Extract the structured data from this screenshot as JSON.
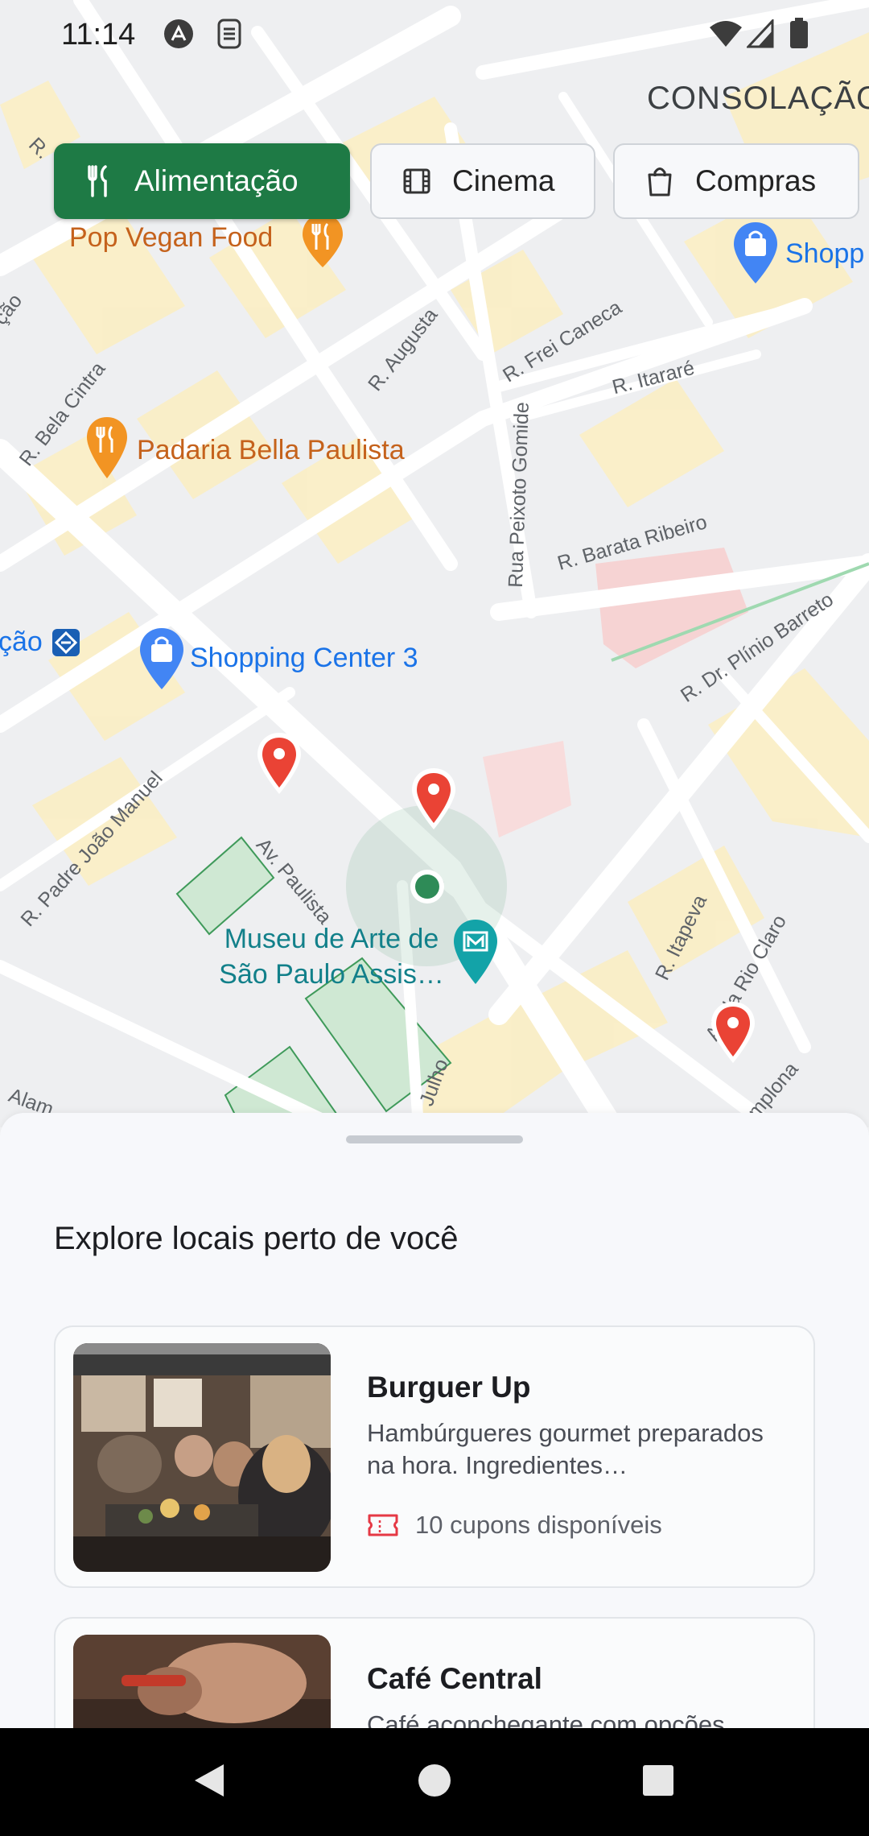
{
  "status_bar": {
    "time": "11:14",
    "icons": [
      "assistant-icon",
      "sim-icon",
      "wifi-icon",
      "signal-icon",
      "battery-icon"
    ]
  },
  "map": {
    "district": "CONSOLAÇÃO",
    "streets": {
      "r_bela_cintra": "R. Bela Cintra",
      "r_augusta": "R. Augusta",
      "r_frei_caneca": "R. Frei Caneca",
      "r_itarare": "R. Itararé",
      "rua_peixoto_gomide": "Rua Peixoto Gomide",
      "r_barata_ribeiro": "R. Barata Ribeiro",
      "r_dr_plinio_barreto": "R. Dr. Plínio Barreto",
      "r_padre_joao_manuel": "R. Padre João Manuel",
      "av_paulista": "Av. Paulista",
      "r_itapeva": "R. Itapeva",
      "al_rio_claro": "Al. da Rio Claro",
      "julho": "Julho",
      "pamplona": "mplona",
      "alam": "Alam",
      "r_corner": "R.",
      "cao": "ção",
      "sao_left": "ção"
    },
    "pois": {
      "pop_vegan": "Pop Vegan Food",
      "padaria": "Padaria Bella Paulista",
      "shopping3": "Shopping Center 3",
      "shopping_right": "Shopp",
      "masp": "Museu de Arte de São Paulo Assis…"
    }
  },
  "categories": [
    {
      "label": "Alimentação",
      "icon": "fork-knife-icon",
      "active": true
    },
    {
      "label": "Cinema",
      "icon": "film-icon",
      "active": false
    },
    {
      "label": "Compras",
      "icon": "shopping-bag-icon",
      "active": false
    }
  ],
  "sheet": {
    "title": "Explore locais perto de você",
    "places": [
      {
        "name": "Burguer Up",
        "description": "Hambúrgueres gourmet preparados na hora. Ingredientes…",
        "coupons": "10 cupons disponíveis"
      },
      {
        "name": "Café Central",
        "description": "Café aconchegante com opções",
        "coupons": ""
      }
    ]
  },
  "colors": {
    "accent": "#1e7a45",
    "pin": "#ea4335",
    "coupon_icon": "#e53945"
  }
}
